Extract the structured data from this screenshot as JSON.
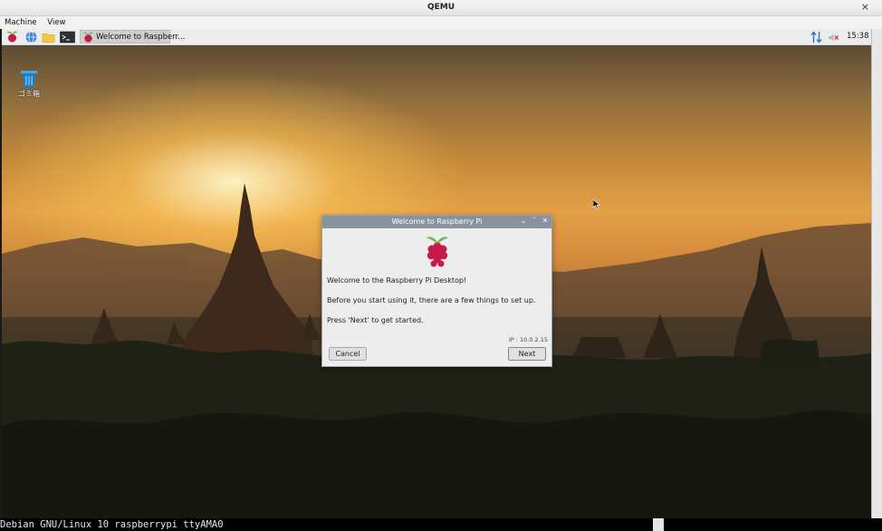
{
  "window": {
    "title": "QEMU",
    "close_glyph": "×"
  },
  "menubar": {
    "items": [
      "Machine",
      "View"
    ]
  },
  "panel": {
    "launchers": [
      "raspberry-menu-icon",
      "globe-browser-icon",
      "folder-icon",
      "terminal-icon"
    ],
    "task_label": "Welcome to Raspberr...",
    "clock": "15:38"
  },
  "desktop": {
    "trash_label": "ゴミ箱"
  },
  "dialog": {
    "title": "Welcome to Raspberry Pi",
    "heading": "Welcome to the Raspberry Pi Desktop!",
    "body1": "Before you start using it, there are a few things to set up.",
    "body2": "Press 'Next' to get started.",
    "ip": "IP : 10.0.2.15",
    "cancel_label": "Cancel",
    "next_label": "Next"
  },
  "console": {
    "text": "Debian GNU/Linux 10 raspberrypi ttyAMA0"
  },
  "colors": {
    "dialog_title_bar": "#88939e",
    "raspberry": "#c51a4a",
    "leaf": "#6cc04a"
  }
}
